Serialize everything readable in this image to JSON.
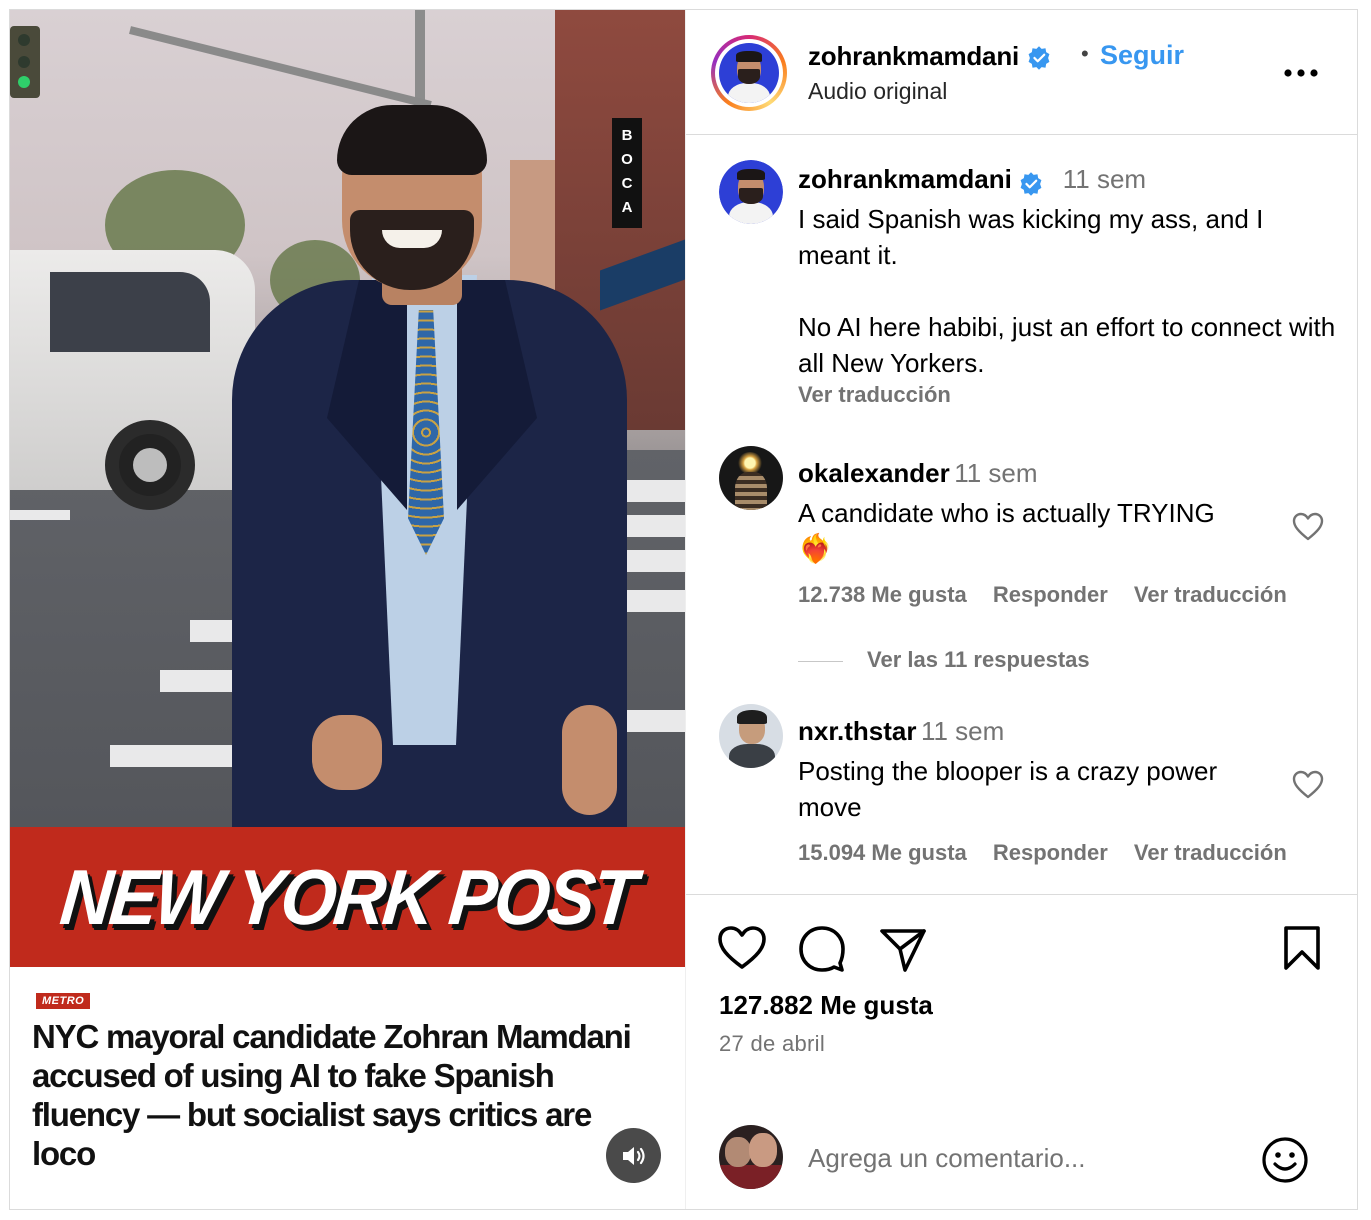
{
  "media": {
    "sign_letters": [
      "B",
      "O",
      "C",
      "A"
    ],
    "masthead": "NEW YORK POST",
    "section_tag": "METRO",
    "headline": "NYC mayoral candidate Zohran Mamdani accused of using AI to fake Spanish fluency — but socialist says critics are loco",
    "sound_icon": "speaker-icon"
  },
  "header": {
    "username": "zohrankmamdani",
    "separator": "•",
    "follow_label": "Seguir",
    "subtitle": "Audio original",
    "more_icon": "more-horizontal-icon"
  },
  "caption": {
    "username": "zohrankmamdani",
    "time": "11 sem",
    "line1": "I said Spanish was kicking my ass, and I meant it.",
    "line2": "No AI here habibi, just an effort to connect with all New Yorkers.",
    "translate": "Ver traducción"
  },
  "comments": [
    {
      "username": "okalexander",
      "time": "11 sem",
      "text": "A candidate who is actually TRYING",
      "emoji": "❤️‍🔥",
      "likes": "12.738 Me gusta",
      "reply": "Responder",
      "translate": "Ver traducción"
    },
    {
      "username": "nxr.thstar",
      "time": "11 sem",
      "text": "Posting the blooper is a crazy power move",
      "likes": "15.094 Me gusta",
      "reply": "Responder",
      "translate": "Ver traducción"
    }
  ],
  "view_replies": "Ver las 11 respuestas",
  "actions": {
    "like_icon": "heart-icon",
    "comment_icon": "comment-icon",
    "share_icon": "send-icon",
    "save_icon": "bookmark-icon",
    "likes": "127.882 Me gusta",
    "date": "27 de abril"
  },
  "add_comment": {
    "placeholder": "Agrega un comentario...",
    "emoji_icon": "smiley-icon"
  },
  "colors": {
    "accent": "#3897f0",
    "masthead_red": "#c02a1c",
    "verified": "#3897f0",
    "muted": "#737373"
  }
}
